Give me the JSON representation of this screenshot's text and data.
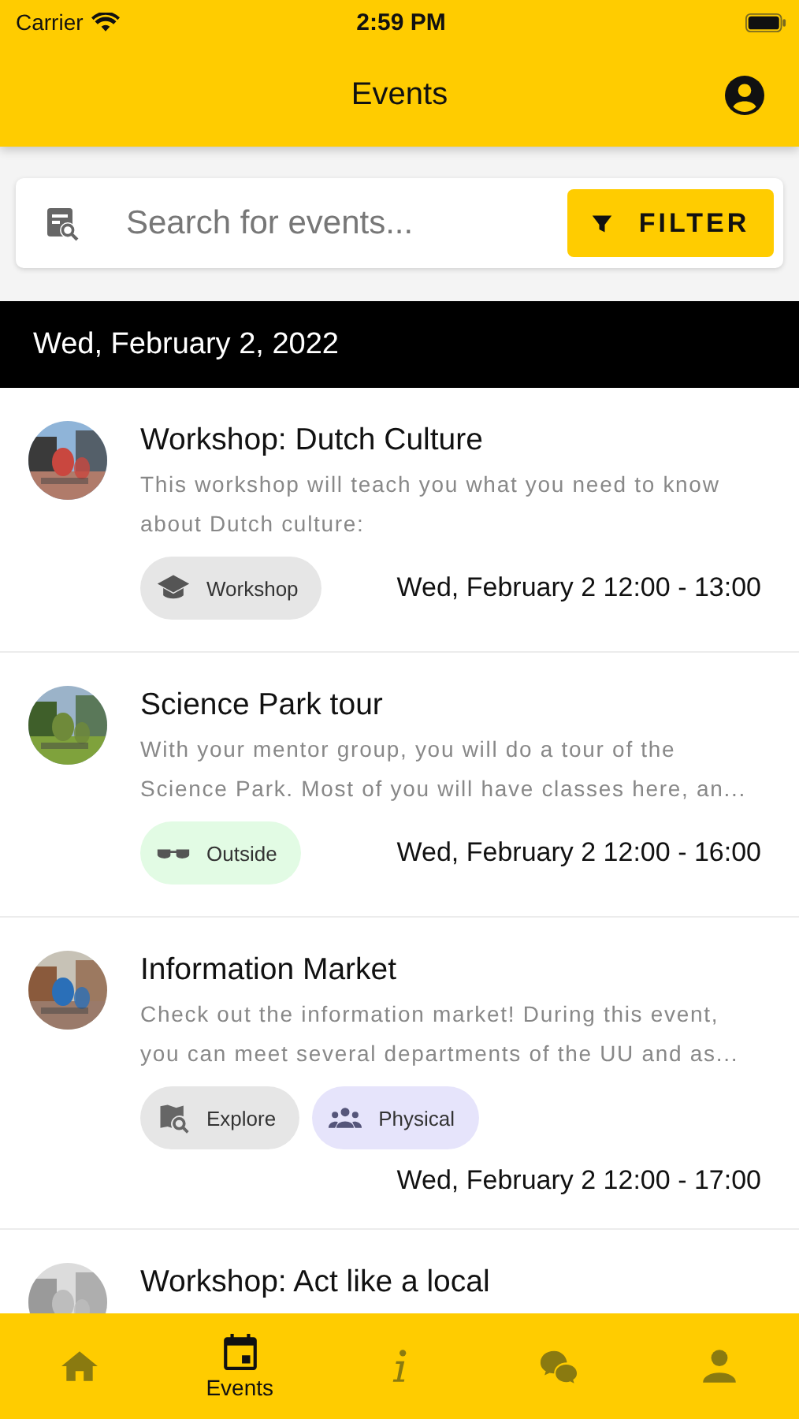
{
  "status_bar": {
    "carrier": "Carrier",
    "time": "2:59 PM"
  },
  "header": {
    "title": "Events"
  },
  "search": {
    "placeholder": "Search for events...",
    "filter_label": "FILTER"
  },
  "date_header": "Wed, February 2, 2022",
  "events": [
    {
      "title": "Workshop: Dutch Culture",
      "description": "This workshop will teach you what you need to know about Dutch culture:",
      "tags": [
        {
          "kind": "workshop",
          "label": "Workshop",
          "color": "#e6e6e6"
        }
      ],
      "time": "Wed, February 2 12:00 - 13:00",
      "picture": {
        "kind": "picture"
      }
    },
    {
      "title": "Science Park tour",
      "description": "With your mentor group, you will do a tour of the Science Park. Most of you will have classes here, an...",
      "tags": [
        {
          "kind": "outside",
          "label": "Outside",
          "color": "#e2fbe4"
        }
      ],
      "time": "Wed, February 2 12:00 - 16:00",
      "picture": {
        "kind": "picture"
      }
    },
    {
      "title": "Information Market",
      "description": "Check out the information market! During this event, you can meet several departments of the UU and as...",
      "tags": [
        {
          "kind": "explore",
          "label": "Explore",
          "color": "#e6e6e6"
        },
        {
          "kind": "physical",
          "label": "Physical",
          "color": "#e6e4fb"
        }
      ],
      "time": "Wed, February 2 12:00 - 17:00",
      "picture": {
        "kind": "picture"
      }
    },
    {
      "title": "Workshop: Act like a local",
      "picture": {
        "kind": "picture"
      }
    }
  ],
  "tab_bar": [
    {
      "kind": "home",
      "selected": false
    },
    {
      "kind": "events",
      "label": "Events",
      "selected": true
    },
    {
      "kind": "info",
      "selected": false
    },
    {
      "kind": "chat",
      "selected": false
    },
    {
      "kind": "profile",
      "selected": false
    }
  ]
}
